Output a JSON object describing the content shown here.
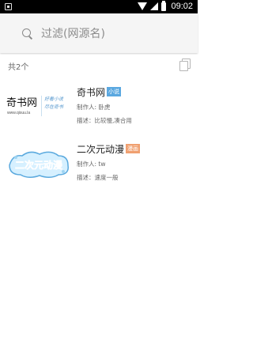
{
  "status_bar": {
    "time": "09:02"
  },
  "search": {
    "placeholder": "过滤(网源名)",
    "value": ""
  },
  "list": {
    "count_label": "共2个",
    "items": [
      {
        "name": "奇书网",
        "tag": "小说",
        "author": "制作人: 卧虎",
        "description": "描述：比较慢,凑合用",
        "logo": {
          "title": "奇书网",
          "url": "www.qisuu.la",
          "slogan_1": "好看小说",
          "slogan_2": "尽在奇书"
        },
        "tag_color": "#5ba8e0"
      },
      {
        "name": "二次元动漫",
        "tag": "漫画",
        "author": "制作人: tw",
        "description": "描述：速度一般",
        "logo": {
          "title": "二次元动漫"
        },
        "tag_color": "#f0a070"
      }
    ]
  },
  "colors": {
    "status_bar": "#000000",
    "app_bar": "#f5f5f5"
  }
}
